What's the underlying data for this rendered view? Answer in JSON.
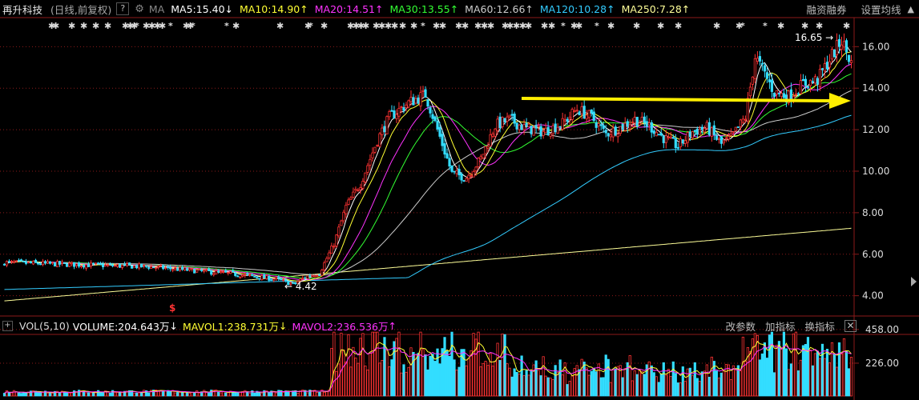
{
  "header": {
    "stock_name": "再升科技",
    "period_info": "(日线,前复权)",
    "help_button": "?",
    "gear_icon": "gear-icon",
    "ma_label": "MA",
    "ma_items": [
      {
        "text": "MA5:15.40",
        "arrow": "↓",
        "color": "#ffffff"
      },
      {
        "text": "MA10:14.90",
        "arrow": "↑",
        "color": "#ffff33"
      },
      {
        "text": "MA20:14.51",
        "arrow": "↑",
        "color": "#ff33ff"
      },
      {
        "text": "MA30:13.55",
        "arrow": "↑",
        "color": "#33ff33"
      },
      {
        "text": "MA60:12.66",
        "arrow": "↑",
        "color": "#cccccc"
      },
      {
        "text": "MA120:10.28",
        "arrow": "↑",
        "color": "#33ccff"
      },
      {
        "text": "MA250:7.28",
        "arrow": "↑",
        "color": "#ffff99"
      }
    ],
    "links": [
      "融资融券",
      "设置均线"
    ],
    "more_icon": "chevron-up-icon"
  },
  "chart_data": {
    "type": "candlestick",
    "y_axis_ticks": [
      "16.00",
      "14.00",
      "12.00",
      "10.00",
      "8.00",
      "6.00",
      "4.00"
    ],
    "ylim": [
      3.1,
      17.4
    ],
    "annotations": {
      "high": "16.65",
      "low": "4.42"
    },
    "ma_lines": [
      "MA5",
      "MA10",
      "MA20",
      "MA30",
      "MA60",
      "MA120",
      "MA250"
    ],
    "trend_arrow_color": "#ffee00"
  },
  "volume": {
    "label": "VOL(5,10)",
    "volume_text": "VOLUME:204.643万",
    "volume_arrow": "↓",
    "mavol1_text": "MAVOL1:238.731万",
    "mavol1_arrow": "↓",
    "mavol2_text": "MAVOL2:236.536万",
    "mavol2_arrow": "↑",
    "links": [
      "改参数",
      "加指标",
      "换指标"
    ],
    "close_icon": "close-icon",
    "y_axis_ticks": [
      "458.00",
      "226.00"
    ],
    "volume_max": 458,
    "colors": {
      "up": "#ff3333",
      "down": "#33ddff",
      "mavol1": "#ffff33",
      "mavol2": "#ff33ff"
    }
  },
  "colors": {
    "up": "#ff3333",
    "down": "#33ddff",
    "background": "#000000",
    "grid": "#8b1a1a"
  }
}
